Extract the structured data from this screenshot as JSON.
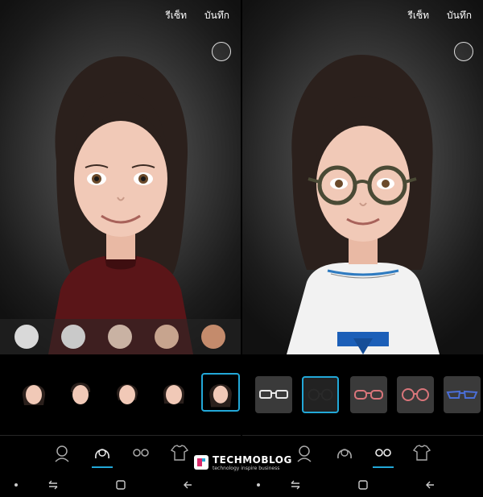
{
  "left_panel": {
    "reset_label": "รีเซ็ท",
    "save_label": "บันทึก",
    "swatch_colors": [
      "#d9d9d9",
      "#c9c9c9",
      "#c9b2a3",
      "#c7a48e",
      "#c48b6c"
    ],
    "thumbnails": [
      "avatar-1",
      "avatar-2",
      "avatar-3",
      "avatar-4",
      "avatar-5"
    ],
    "selected_thumbnail": 4,
    "active_tab": "hairstyle-icon"
  },
  "right_panel": {
    "reset_label": "รีเซ็ท",
    "save_label": "บันทึก",
    "glasses_colors": [
      "#e8e8e8",
      "#2a2a2a",
      "#d9757a",
      "#d9757a",
      "#4a6ed6"
    ],
    "selected_glasses": 1,
    "active_tab": "glasses-icon"
  },
  "watermark": {
    "title": "TECHMOBLOG",
    "subtitle": "technology inspire business"
  },
  "colors": {
    "accent": "#22a8d8",
    "hair": "#2b201c",
    "skin": "#f1c9b7",
    "left_shirt": "#5a1518",
    "right_dress": "#f2f2f2",
    "belt": "#1c5fb8"
  }
}
